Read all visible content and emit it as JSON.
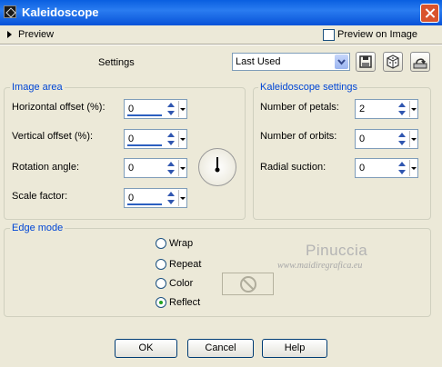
{
  "window": {
    "title": "Kaleidoscope"
  },
  "preview": {
    "label": "Preview",
    "checkbox_label": "Preview on Image",
    "checked": false
  },
  "settings": {
    "label": "Settings",
    "preset_value": "Last Used"
  },
  "image_area": {
    "title": "Image area",
    "horizontal_offset": {
      "label": "Horizontal offset (%):",
      "value": "0"
    },
    "vertical_offset": {
      "label": "Vertical offset (%):",
      "value": "0"
    },
    "rotation_angle": {
      "label": "Rotation angle:",
      "value": "0"
    },
    "scale_factor": {
      "label": "Scale factor:",
      "value": "0"
    }
  },
  "kaleidoscope_settings": {
    "title": "Kaleidoscope settings",
    "petals": {
      "label": "Number of petals:",
      "value": "2"
    },
    "orbits": {
      "label": "Number of orbits:",
      "value": "0"
    },
    "radial_suction": {
      "label": "Radial suction:",
      "value": "0"
    }
  },
  "edge_mode": {
    "title": "Edge mode",
    "options": [
      "Wrap",
      "Repeat",
      "Color",
      "Reflect"
    ],
    "selected": "Reflect"
  },
  "watermark": {
    "name": "Pinuccia",
    "url": "www.maidiregrafica.eu"
  },
  "buttons": {
    "ok": "OK",
    "cancel": "Cancel",
    "help": "Help"
  },
  "icons": [
    "save-icon",
    "randomize-dice-icon",
    "reset-icon",
    "no-color-icon",
    "dial-icon"
  ]
}
